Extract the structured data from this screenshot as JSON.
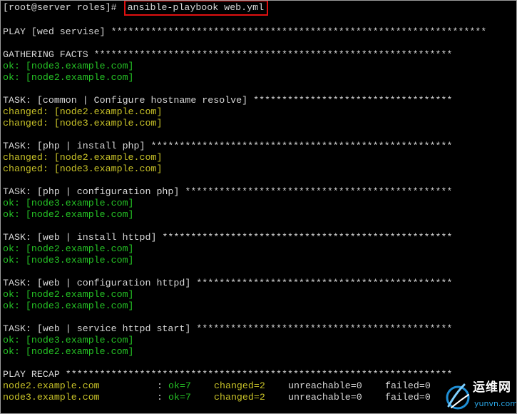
{
  "terminal": {
    "prompt": "[root@server roles]# ",
    "command": "ansible-playbook web.yml",
    "play_line": "PLAY [wed servise] ******************************************************************",
    "gathering": "GATHERING FACTS ***************************************************************",
    "gathering_ok1": "ok: [node3.example.com]",
    "gathering_ok2": "ok: [node2.example.com]",
    "task1": "TASK: [common | Configure hostname resolve] ***********************************",
    "task1_r1": "changed: [node2.example.com]",
    "task1_r2": "changed: [node3.example.com]",
    "task2": "TASK: [php | install php] *****************************************************",
    "task2_r1": "changed: [node2.example.com]",
    "task2_r2": "changed: [node3.example.com]",
    "task3": "TASK: [php | configuration php] ***********************************************",
    "task3_r1": "ok: [node3.example.com]",
    "task3_r2": "ok: [node2.example.com]",
    "task4": "TASK: [web | install httpd] ***************************************************",
    "task4_r1": "ok: [node2.example.com]",
    "task4_r2": "ok: [node3.example.com]",
    "task5": "TASK: [web | configuration httpd] *********************************************",
    "task5_r1": "ok: [node2.example.com]",
    "task5_r2": "ok: [node3.example.com]",
    "task6": "TASK: [web | service httpd start] *********************************************",
    "task6_r1": "ok: [node3.example.com]",
    "task6_r2": "ok: [node2.example.com]",
    "recap_header": "PLAY RECAP ********************************************************************",
    "recap_rows": [
      {
        "host": "node2.example.com",
        "colon": ":",
        "ok": "ok=7",
        "changed": "changed=2",
        "unreachable": "unreachable=0",
        "failed": "failed=0"
      },
      {
        "host": "node3.example.com",
        "colon": ":",
        "ok": "ok=7",
        "changed": "changed=2",
        "unreachable": "unreachable=0",
        "failed": "failed=0"
      }
    ]
  },
  "watermark": {
    "brand": "运维网",
    "url": "yunvn.com"
  },
  "colors": {
    "background": "#000000",
    "text": "#d8d8d8",
    "ok": "#25c225",
    "changed": "#c8c228",
    "highlight_box": "#e01010"
  }
}
